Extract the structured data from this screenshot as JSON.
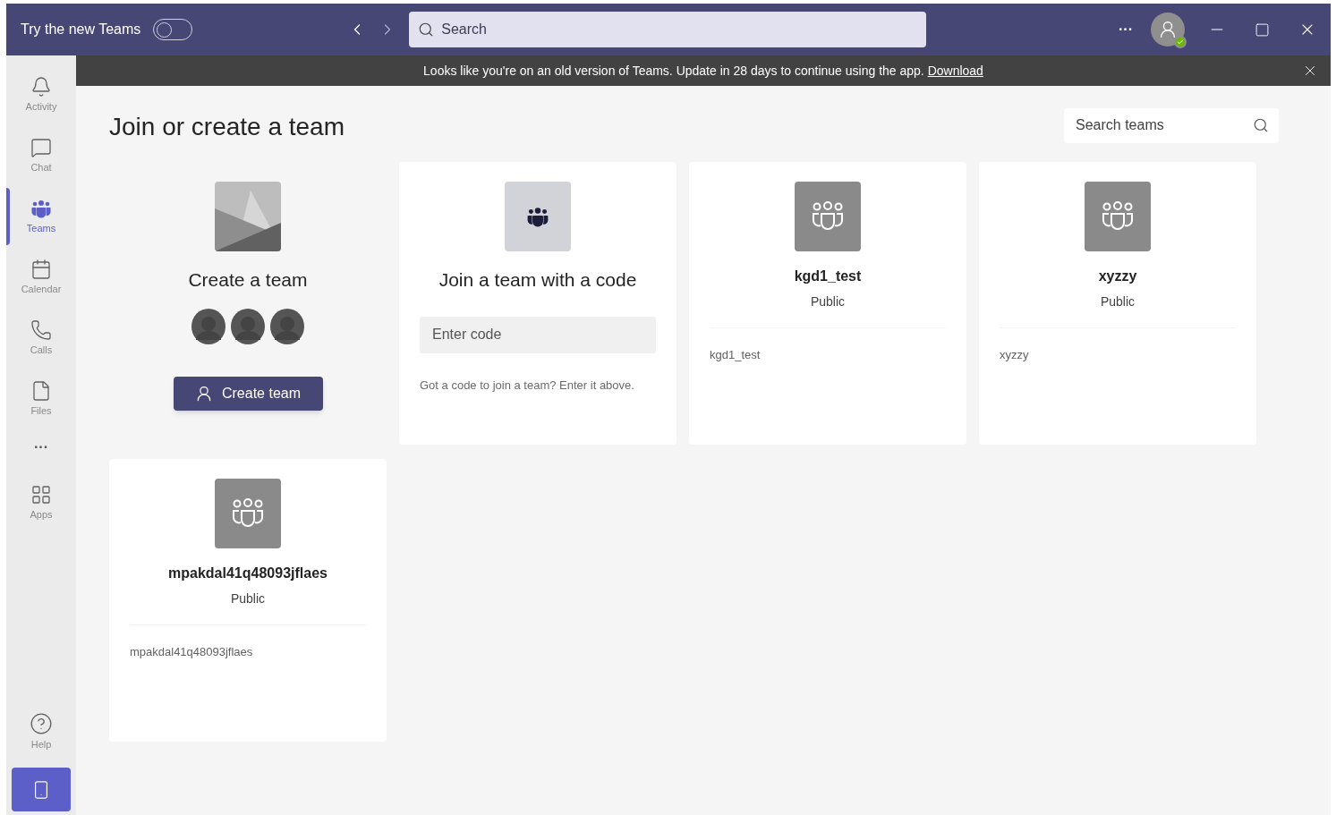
{
  "title_bar": {
    "new_teams": {
      "label": "Try the new Teams",
      "on": false
    },
    "search": {
      "placeholder": "Search"
    },
    "more": "···"
  },
  "banner": {
    "message": "Looks like you're on an old version of Teams. Update in 28 days to continue using the app.",
    "link": "Download"
  },
  "sidebar": {
    "items": [
      {
        "label": "Activity",
        "kind": "bell",
        "selected": false
      },
      {
        "label": "Chat",
        "kind": "chat",
        "selected": false
      },
      {
        "label": "Teams",
        "kind": "teams",
        "selected": true
      },
      {
        "label": "Calendar",
        "kind": "calendar",
        "selected": false
      },
      {
        "label": "Calls",
        "kind": "calls",
        "selected": false
      },
      {
        "label": "Files",
        "kind": "files",
        "selected": false
      }
    ],
    "more": "···",
    "apps": "Apps",
    "help": "Help"
  },
  "page": {
    "title": "Join or create a team",
    "search": {
      "placeholder": "Search teams"
    },
    "create_card": {
      "title": "Create a team",
      "button": "Create team"
    },
    "join_card": {
      "title": "Join a team with a code",
      "placeholder": "Enter code",
      "hint": "Got a code to join a team? Enter it above."
    },
    "teams": [
      {
        "name": "kgd1_test",
        "visibility": "Public",
        "description": "kgd1_test"
      },
      {
        "name": "xyzzy",
        "visibility": "Public",
        "description": "xyzzy"
      },
      {
        "name": "mpakdal41q48093jflaes",
        "visibility": "Public",
        "description": "mpakdal41q48093jflaes"
      }
    ]
  }
}
